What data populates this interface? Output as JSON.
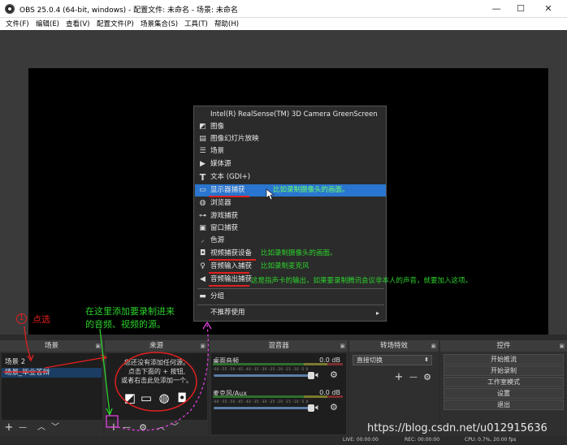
{
  "window": {
    "title": "OBS 25.0.4 (64-bit, windows) - 配置文件: 未命名 - 场景: 未命名",
    "minimize": "—",
    "maximize": "☐",
    "close": "✕"
  },
  "menu": [
    "文件(F)",
    "编辑(E)",
    "查看(V)",
    "配置文件(P)",
    "场景集合(S)",
    "工具(T)",
    "帮助(H)"
  ],
  "context_menu": {
    "items": [
      {
        "icon": "camera-icon",
        "glyph": "",
        "label": "Intel(R) RealSense(TM) 3D Camera GreenScreen"
      },
      {
        "icon": "image-icon",
        "glyph": "◩",
        "label": "图像"
      },
      {
        "icon": "slideshow-icon",
        "glyph": "▤",
        "label": "图像幻灯片放映"
      },
      {
        "icon": "scene-list-icon",
        "glyph": "☰",
        "label": "场景"
      },
      {
        "icon": "play-icon",
        "glyph": "▶",
        "label": "媒体源"
      },
      {
        "icon": "text-icon",
        "glyph": "T",
        "label": "文本 (GDI+)"
      },
      {
        "icon": "monitor-icon",
        "glyph": "▭",
        "label": "显示器捕获"
      },
      {
        "icon": "globe-icon",
        "glyph": "◍",
        "label": "浏览器"
      },
      {
        "icon": "gamepad-icon",
        "glyph": "⊶",
        "label": "游戏捕获"
      },
      {
        "icon": "window-icon",
        "glyph": "▣",
        "label": "窗口捕获"
      },
      {
        "icon": "brush-icon",
        "glyph": "⸝",
        "label": "色源"
      },
      {
        "icon": "video-camera-icon",
        "glyph": "◘",
        "label": "视频捕获设备"
      },
      {
        "icon": "microphone-icon",
        "glyph": "♀",
        "label": "音频输入捕获"
      },
      {
        "icon": "speaker-icon",
        "glyph": "◀",
        "label": "音频输出捕获"
      },
      {
        "icon": "folder-icon",
        "glyph": "▬",
        "label": "分组"
      },
      {
        "icon": "",
        "glyph": "",
        "label": "不推荐使用"
      }
    ],
    "highlighted_index": 6,
    "submenu_arrow": "▸"
  },
  "annotations": {
    "monitor_note": "比如录制摄像头的画面。",
    "video_device_note": "比如录制摄像头的画面。",
    "audio_input_note": "比如录制麦克风",
    "audio_output_note": "这是指声卡的输出，如果要录制腾讯会议非本人的声音，就要加入这项。",
    "step_number": "1",
    "step_label": "点选",
    "add_here_line1": "在这里添加要录制进来",
    "add_here_line2": "的音频、视频的源。"
  },
  "docks": {
    "scenes": {
      "title": "场景",
      "items": [
        "场景 2",
        "场景_毕业答辩"
      ],
      "selected_index": 1
    },
    "sources": {
      "title": "来源",
      "empty_line1": "您还没有添加任何源。",
      "empty_line2": "点击下面的 + 按钮,",
      "empty_line3": "或者右击此处添加一个。"
    },
    "mixer": {
      "title": "混音器",
      "channels": [
        {
          "name": "桌面音频",
          "db": "0.0 dB",
          "level": 0.78
        },
        {
          "name": "麦克风/Aux",
          "db": "0.0 dB",
          "level": 0.78
        }
      ],
      "scale": "-60 -55 -50 -45 -40 -35 -30 -25 -20 -15 -10 -5 0"
    },
    "transitions": {
      "title": "转场特效",
      "selected": "直接切换"
    },
    "controls": {
      "title": "控件",
      "buttons": [
        "开始推流",
        "开始录制",
        "工作室模式",
        "设置",
        "退出"
      ]
    }
  },
  "toolbar": {
    "add": "+",
    "remove": "—",
    "settings": "⚙",
    "up": "︿",
    "down": "﹀"
  },
  "status": {
    "live": "LIVE: 00:00:00",
    "rec": "REC: 00:00:00",
    "cpu": "CPU: 0.7%, 20.00 fps"
  },
  "watermark": "https://blog.csdn.net/u012915636",
  "colors": {
    "accent_highlight": "#2a75cf",
    "annotation_red": "#e02020",
    "annotation_green": "#2cd02c",
    "annotation_magenta": "#e040e0",
    "dock_bg": "#2b2b2b"
  }
}
